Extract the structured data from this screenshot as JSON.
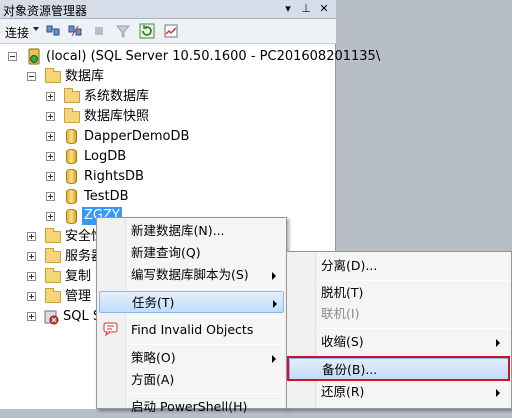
{
  "panel": {
    "title": "对象资源管理器",
    "pin_glyph": "▾",
    "pin2_glyph": "⊥",
    "close_glyph": "✕",
    "connect_label": "连接"
  },
  "toolbar_icons": [
    "connect-icon",
    "disconnect-icon",
    "stop-icon",
    "filter-icon",
    "refresh-icon",
    "activity-icon"
  ],
  "tree": {
    "server": "(local) (SQL Server 10.50.1600 - PC201608201135\\",
    "databases_folder": "数据库",
    "items": [
      {
        "label": "系统数据库",
        "type": "folder"
      },
      {
        "label": "数据库快照",
        "type": "folder"
      },
      {
        "label": "DapperDemoDB",
        "type": "db"
      },
      {
        "label": "LogDB",
        "type": "db"
      },
      {
        "label": "RightsDB",
        "type": "db"
      },
      {
        "label": "TestDB",
        "type": "db"
      },
      {
        "label": "ZGZY",
        "type": "db"
      }
    ],
    "top_folders": [
      "安全性",
      "服务器",
      "复制",
      "管理"
    ],
    "agent": "SQL S"
  },
  "context_menu": {
    "items": [
      {
        "label": "新建数据库(N)..."
      },
      {
        "label": "新建查询(Q)"
      },
      {
        "label": "编写数据库脚本为(S)",
        "submenu": true
      },
      {
        "label": "任务(T)",
        "submenu": true,
        "highlighted": true
      },
      {
        "label": "Find Invalid Objects"
      },
      {
        "label": "策略(O)",
        "submenu": true
      },
      {
        "label": "方面(A)"
      },
      {
        "label": "启动 PowerShell(H)"
      }
    ]
  },
  "tasks_menu": {
    "items": [
      {
        "label": "分离(D)..."
      },
      {
        "label": "脱机(T)"
      },
      {
        "label": "联机(I)",
        "disabled": true
      },
      {
        "label": "收缩(S)",
        "submenu": true
      },
      {
        "label": "备份(B)...",
        "highlighted": true
      },
      {
        "label": "还原(R)",
        "submenu": true
      }
    ]
  },
  "colors": {
    "highlight": "#c2dcf7",
    "selected_node": "#3399ff",
    "annotation_outline": "#d0102a"
  }
}
